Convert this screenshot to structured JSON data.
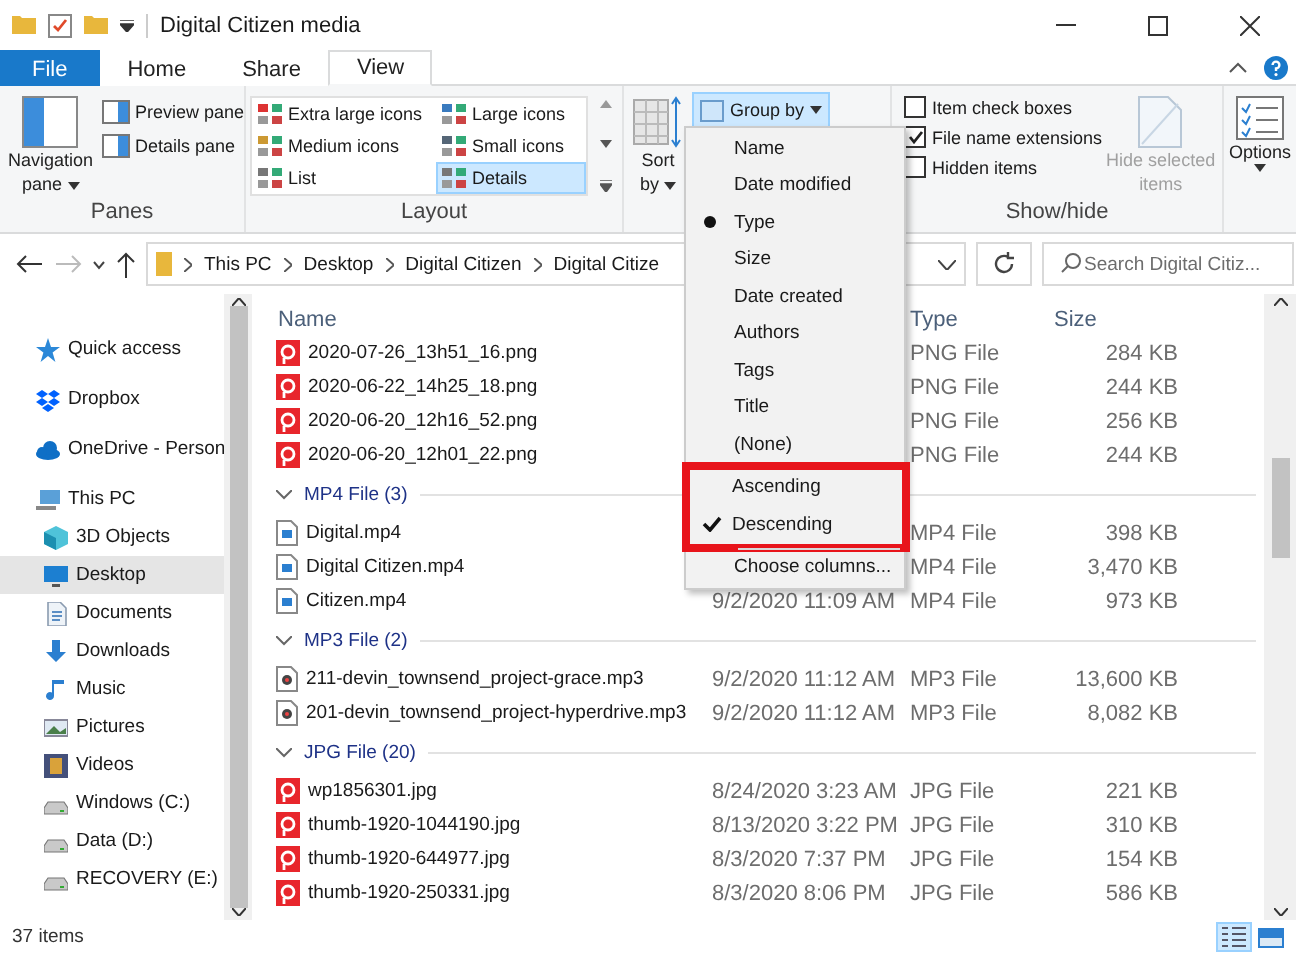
{
  "window": {
    "title": "Digital Citizen media"
  },
  "ribbon_tabs": [
    {
      "label": "File",
      "kind": "file",
      "selected": false
    },
    {
      "label": "Home",
      "kind": "tab",
      "selected": false
    },
    {
      "label": "Share",
      "kind": "tab",
      "selected": false
    },
    {
      "label": "View",
      "kind": "tab",
      "selected": true
    }
  ],
  "panes": {
    "label": "Panes",
    "navigation": "Navigation",
    "navigation_line2": "pane",
    "preview": "Preview pane",
    "details": "Details pane"
  },
  "layout": {
    "label": "Layout",
    "options": [
      {
        "label": "Extra large icons",
        "selected": false
      },
      {
        "label": "Large icons",
        "selected": false
      },
      {
        "label": "Medium icons",
        "selected": false
      },
      {
        "label": "Small icons",
        "selected": false
      },
      {
        "label": "List",
        "selected": false
      },
      {
        "label": "Details",
        "selected": true
      }
    ]
  },
  "current_view": {
    "sort_label": "Sort",
    "sort_line2": "by",
    "group_by": "Group by"
  },
  "show_hide": {
    "label": "Show/hide",
    "checkboxes": [
      {
        "label": "Item check boxes",
        "checked": false
      },
      {
        "label": "File name extensions",
        "checked": true
      },
      {
        "label": "Hidden items",
        "checked": false
      }
    ],
    "hide_selected": "Hide selected",
    "hide_selected_line2": "items"
  },
  "options": {
    "label": "Options"
  },
  "address": {
    "crumbs": [
      "This PC",
      "Desktop",
      "Digital Citizen",
      "Digital Citize"
    ]
  },
  "search": {
    "placeholder": "Search Digital Citiz..."
  },
  "sidebar": {
    "items": [
      {
        "label": "Quick access",
        "kind": "star",
        "selected": false
      },
      {
        "label": "Dropbox",
        "kind": "dropbox",
        "selected": false
      },
      {
        "label": "OneDrive - Person",
        "kind": "cloud",
        "selected": false
      },
      {
        "label": "This PC",
        "kind": "pc",
        "selected": false,
        "children": [
          {
            "label": "3D Objects",
            "kind": "cube",
            "selected": false
          },
          {
            "label": "Desktop",
            "kind": "desktop",
            "selected": true
          },
          {
            "label": "Documents",
            "kind": "docs",
            "selected": false
          },
          {
            "label": "Downloads",
            "kind": "download",
            "selected": false
          },
          {
            "label": "Music",
            "kind": "music",
            "selected": false
          },
          {
            "label": "Pictures",
            "kind": "pictures",
            "selected": false
          },
          {
            "label": "Videos",
            "kind": "videos",
            "selected": false
          },
          {
            "label": "Windows (C:)",
            "kind": "drive",
            "selected": false
          },
          {
            "label": "Data (D:)",
            "kind": "drive",
            "selected": false
          },
          {
            "label": "RECOVERY (E:)",
            "kind": "drive",
            "selected": false
          }
        ]
      }
    ]
  },
  "table": {
    "columns": {
      "name": "Name",
      "type": "Type",
      "size": "Size"
    },
    "groups": [
      {
        "rows": [
          {
            "name": "2020-07-26_13h51_16.png",
            "kind": "image",
            "type": "PNG File",
            "size": "284 KB"
          },
          {
            "name": "2020-06-22_14h25_18.png",
            "kind": "image",
            "type": "PNG File",
            "size": "244 KB"
          },
          {
            "name": "2020-06-20_12h16_52.png",
            "kind": "image",
            "type": "PNG File",
            "size": "256 KB"
          },
          {
            "name": "2020-06-20_12h01_22.png",
            "kind": "image",
            "type": "PNG File",
            "size": "244 KB"
          }
        ]
      },
      {
        "heading": "MP4 File (3)",
        "rows": [
          {
            "name": "Digital.mp4",
            "kind": "video",
            "type": "MP4 File",
            "size": "398 KB"
          },
          {
            "name": "Digital Citizen.mp4",
            "kind": "video",
            "type": "MP4 File",
            "size": "3,470 KB"
          },
          {
            "name": "Citizen.mp4",
            "kind": "video",
            "date": "9/2/2020 11:09 AM",
            "type": "MP4 File",
            "size": "973 KB"
          }
        ]
      },
      {
        "heading": "MP3 File (2)",
        "rows": [
          {
            "name": "211-devin_townsend_project-grace.mp3",
            "kind": "audio",
            "date": "9/2/2020 11:12 AM",
            "type": "MP3 File",
            "size": "13,600 KB"
          },
          {
            "name": "201-devin_townsend_project-hyperdrive.mp3",
            "kind": "audio",
            "date": "9/2/2020 11:12 AM",
            "type": "MP3 File",
            "size": "8,082 KB"
          }
        ]
      },
      {
        "heading": "JPG File (20)",
        "rows": [
          {
            "name": "wp1856301.jpg",
            "kind": "image",
            "date": "8/24/2020 3:23 AM",
            "type": "JPG File",
            "size": "221 KB"
          },
          {
            "name": "thumb-1920-1044190.jpg",
            "kind": "image",
            "date": "8/13/2020 3:22 PM",
            "type": "JPG File",
            "size": "310 KB"
          },
          {
            "name": "thumb-1920-644977.jpg",
            "kind": "image",
            "date": "8/3/2020 7:37 PM",
            "type": "JPG File",
            "size": "154 KB"
          },
          {
            "name": "thumb-1920-250331.jpg",
            "kind": "image",
            "date": "8/3/2020 8:06 PM",
            "type": "JPG File",
            "size": "586 KB"
          }
        ]
      }
    ]
  },
  "group_by_menu": {
    "options": [
      {
        "label": "Name",
        "selected": false
      },
      {
        "label": "Date modified",
        "selected": false
      },
      {
        "label": "Type",
        "selected": true
      },
      {
        "label": "Size",
        "selected": false
      },
      {
        "label": "Date created",
        "selected": false
      },
      {
        "label": "Authors",
        "selected": false
      },
      {
        "label": "Tags",
        "selected": false
      },
      {
        "label": "Title",
        "selected": false
      },
      {
        "label": "(None)",
        "selected": false
      }
    ],
    "order": [
      {
        "label": "Ascending",
        "selected": false
      },
      {
        "label": "Descending",
        "selected": true
      }
    ],
    "order_highlighted": true,
    "footer": "Choose columns..."
  },
  "status_bar": {
    "count": "37 items",
    "views": [
      {
        "kind": "details",
        "selected": true
      },
      {
        "kind": "large",
        "selected": false
      }
    ]
  }
}
